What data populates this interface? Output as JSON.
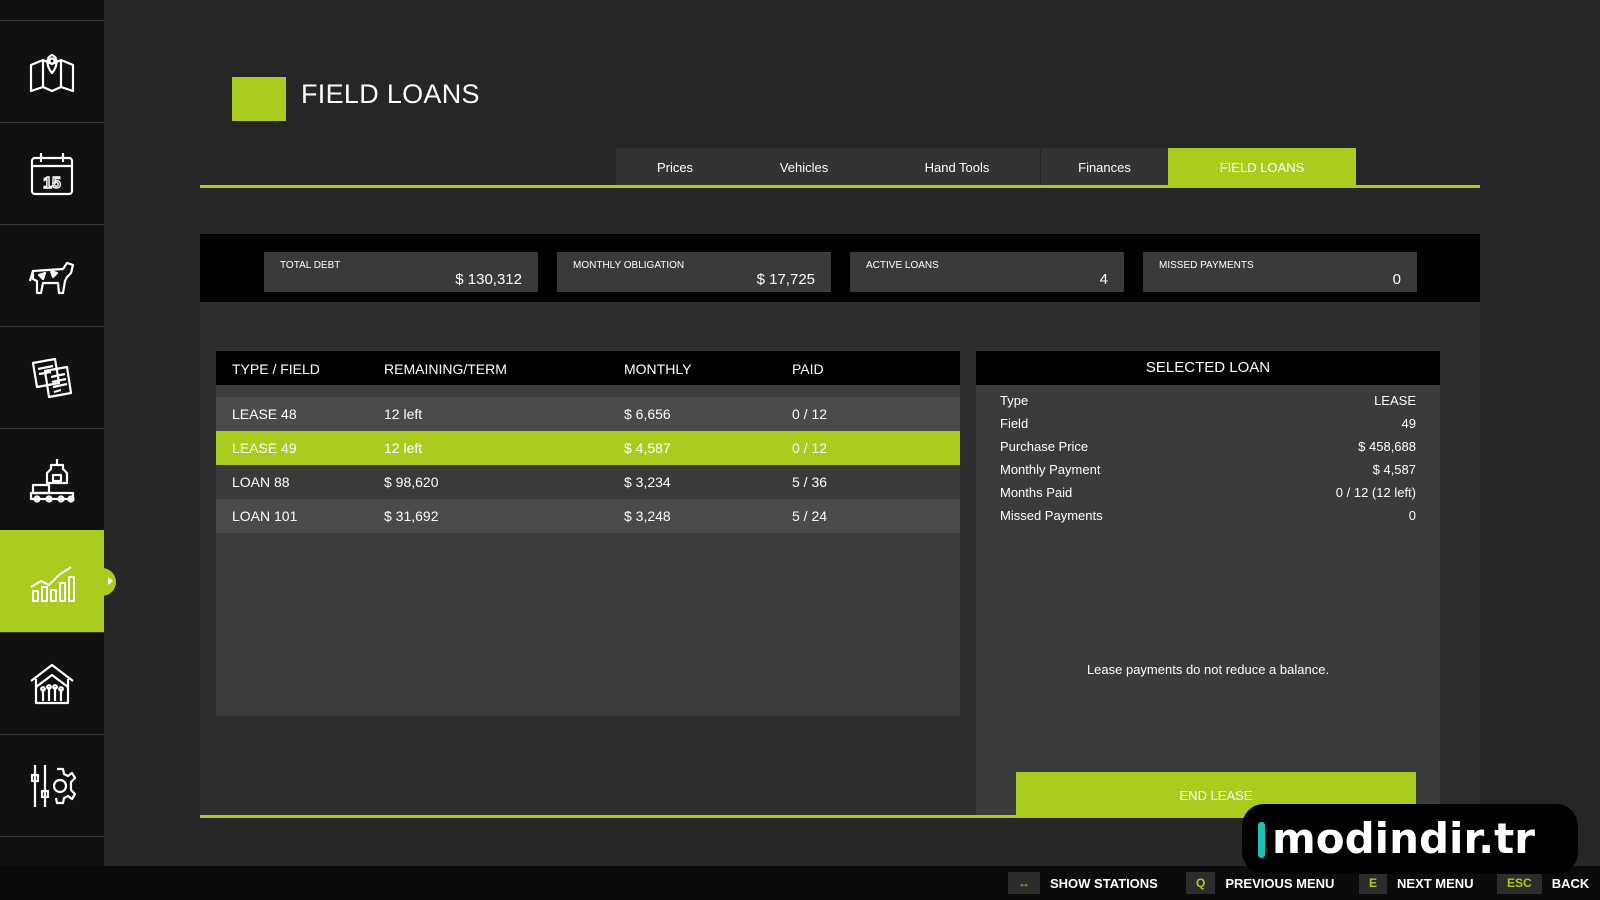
{
  "sidebar": {
    "items": [
      {
        "icon": "map-icon"
      },
      {
        "icon": "calendar-icon",
        "label": "15"
      },
      {
        "icon": "cow-icon"
      },
      {
        "icon": "documents-icon"
      },
      {
        "icon": "production-icon"
      },
      {
        "icon": "bar-chart-icon",
        "active": true
      },
      {
        "icon": "barn-icon"
      },
      {
        "icon": "settings-sliders-icon"
      }
    ]
  },
  "header": {
    "title": "FIELD LOANS"
  },
  "tabs": [
    "Prices",
    "Vehicles",
    "Hand Tools",
    "Finances",
    "FIELD LOANS"
  ],
  "active_tab": "FIELD LOANS",
  "stats": [
    {
      "label": "TOTAL DEBT",
      "value": "$ 130,312"
    },
    {
      "label": "MONTHLY OBLIGATION",
      "value": "$ 17,725"
    },
    {
      "label": "ACTIVE LOANS",
      "value": "4"
    },
    {
      "label": "MISSED PAYMENTS",
      "value": "0"
    }
  ],
  "table": {
    "columns": [
      "TYPE / FIELD",
      "REMAINING/TERM",
      "MONTHLY",
      "PAID"
    ],
    "rows": [
      [
        "LEASE 48",
        "12 left",
        "$ 6,656",
        "0 / 12"
      ],
      [
        "LEASE 49",
        "12 left",
        "$ 4,587",
        "0 / 12"
      ],
      [
        "LOAN 88",
        "$ 98,620",
        "$ 3,234",
        "5 / 36"
      ],
      [
        "LOAN 101",
        "$ 31,692",
        "$ 3,248",
        "5 / 24"
      ]
    ],
    "selected_row": "LEASE 49"
  },
  "selected_loan": {
    "title": "SELECTED LOAN",
    "fields": [
      {
        "key": "Type",
        "value": "LEASE"
      },
      {
        "key": "Field",
        "value": "49"
      },
      {
        "key": "Purchase Price",
        "value": "$ 458,688"
      },
      {
        "key": "Monthly Payment",
        "value": "$ 4,587"
      },
      {
        "key": "Months Paid",
        "value": "0 / 12 (12 left)"
      },
      {
        "key": "Missed Payments",
        "value": "0"
      }
    ],
    "note": "Lease payments do not reduce a balance.",
    "action_label": "END LEASE"
  },
  "bottom_bar": [
    {
      "key": "↔",
      "label": "SHOW STATIONS"
    },
    {
      "key": "Q",
      "label": "PREVIOUS MENU"
    },
    {
      "key": "E",
      "label": "NEXT MENU"
    },
    {
      "key": "ESC",
      "label": "BACK"
    }
  ],
  "watermark": {
    "text": "modindir.tr"
  },
  "colors": {
    "accent": "#a9cc1f",
    "background": "#262626",
    "sidebar": "#111111"
  }
}
